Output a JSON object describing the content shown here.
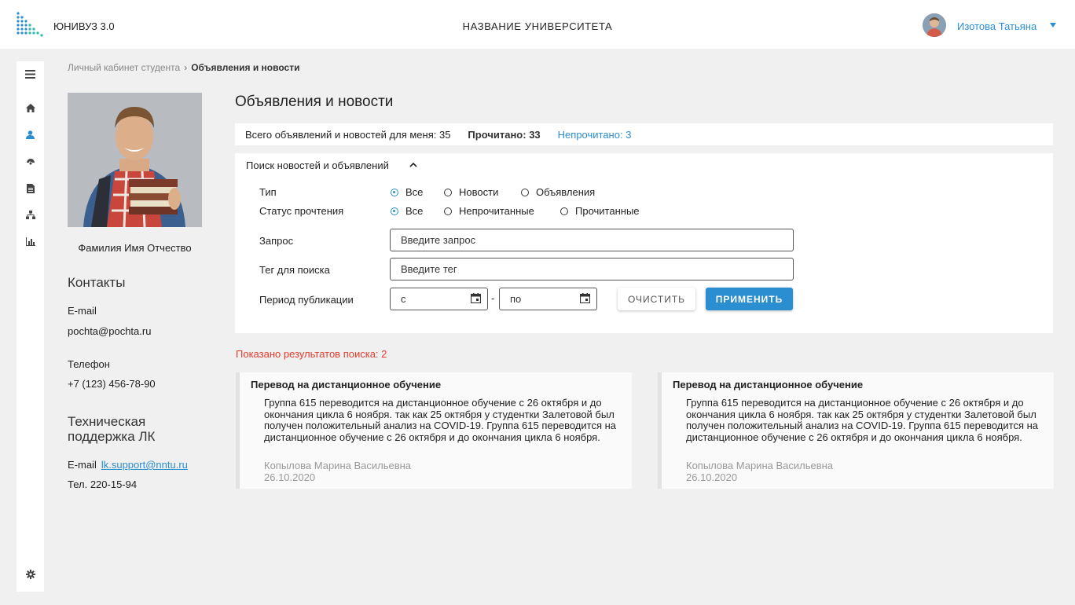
{
  "header": {
    "brand": "ЮНИВУЗ 3.0",
    "university": "НАЗВАНИЕ УНИВЕРСИТЕТА",
    "user_name": "Изотова Татьяна"
  },
  "rail_icons": [
    "menu-icon",
    "home-icon",
    "user-icon",
    "dashboard-icon",
    "document-icon",
    "structure-icon",
    "chart-icon",
    "gear-icon"
  ],
  "breadcrumb": {
    "parent": "Личный кабинет студента",
    "current": "Объявления и новости"
  },
  "profile": {
    "full_name": "Фамилия Имя Отчество",
    "contacts_heading": "Контакты",
    "email_label": "E-mail",
    "email_value": "pochta@pochta.ru",
    "phone_label": "Телефон",
    "phone_value": "+7 (123) 456-78-90",
    "support_heading_line1": "Техническая",
    "support_heading_line2": "поддержка ЛК",
    "support_email_label": "E-mail",
    "support_email_value": "lk.support@nntu.ru",
    "support_phone": "Тел. 220-15-94"
  },
  "main": {
    "title": "Объявления и новости",
    "stats": {
      "total": "Всего объявлений и новостей для меня: 35",
      "read": "Прочитано: 33",
      "unread": "Непрочитано: 3"
    },
    "search": {
      "title": "Поиск новостей и объявлений",
      "type_label": "Тип",
      "type_options": [
        "Все",
        "Новости",
        "Объявления"
      ],
      "type_selected": "Все",
      "status_label": "Статус прочтения",
      "status_options": [
        "Все",
        "Непрочитанные",
        "Прочитанные"
      ],
      "status_selected": "Все",
      "query_label": "Запрос",
      "query_placeholder": "Введите запрос",
      "tag_label": "Тег для поиска",
      "tag_placeholder": "Введите тег",
      "period_label": "Период публикации",
      "date_from_placeholder": "с",
      "date_to_placeholder": "по",
      "date_separator": "-",
      "clear_button": "ОЧИСТИТЬ",
      "apply_button": "ПРИМЕНИТЬ"
    },
    "results_text": "Показано результатов поиска: 2",
    "cards": [
      {
        "title": "Перевод на дистанционное обучение",
        "text": "Группа 615 переводится на дистанционное обучение с 26 октября и до окончания цикла 6 ноября. так как 25 октября у студентки Залетовой был получен положительный анализ на COVID-19. Группа 615 переводится на дистанционное обучение с 26 октября и до окончания цикла 6 ноября.",
        "author": "Копылова Марина Васильевна",
        "date": "26.10.2020"
      },
      {
        "title": "Перевод на дистанционное обучение",
        "text": "Группа 615 переводится на дистанционное обучение с 26 октября и до окончания цикла 6 ноября. так как 25 октября у студентки Залетовой был получен положительный анализ на COVID-19. Группа 615 переводится на дистанционное обучение с 26 октября и до окончания цикла 6 ноября.",
        "author": "Копылова Марина Васильевна",
        "date": "26.10.2020"
      }
    ]
  },
  "colors": {
    "accent": "#2a8ed1",
    "results_red": "#e53b2c",
    "background": "#f0f0f0"
  }
}
